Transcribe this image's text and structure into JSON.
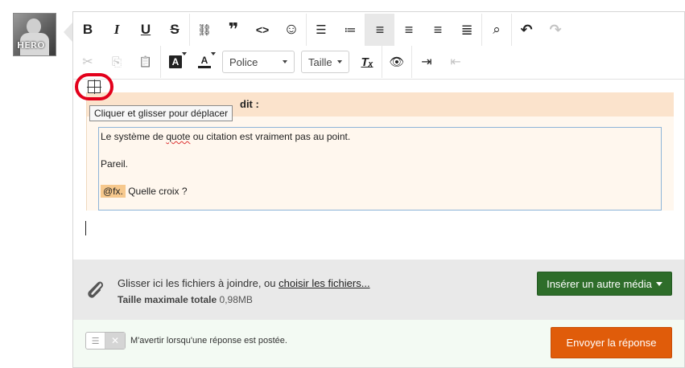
{
  "colors": {
    "accent_red_circle": "#e3001b",
    "media_button": "#2e6d2a",
    "send_button": "#e05c0a",
    "quote_header_bg": "#fbe3cc",
    "mention_bg": "#f6c88d"
  },
  "avatar": {
    "text": "HERO"
  },
  "toolbar": {
    "row1": [
      {
        "name": "bold-button",
        "glyph": "B",
        "icon": "bold-icon"
      },
      {
        "name": "italic-button",
        "glyph": "I",
        "icon": "italic-icon"
      },
      {
        "name": "underline-button",
        "glyph": "U",
        "icon": "underline-icon"
      },
      {
        "name": "strikethrough-button",
        "glyph": "S",
        "icon": "strikethrough-icon"
      },
      {
        "name": "link-button",
        "glyph": "⛓",
        "icon": "link-icon"
      },
      {
        "name": "quote-button",
        "glyph": "❞",
        "icon": "quote-icon"
      },
      {
        "name": "code-button",
        "glyph": "<>",
        "icon": "code-icon"
      },
      {
        "name": "smiley-button",
        "glyph": "☺",
        "icon": "smiley-icon"
      },
      {
        "name": "bullet-list-button",
        "glyph": "☰",
        "icon": "bullet-list-icon"
      },
      {
        "name": "numbered-list-button",
        "glyph": "≔",
        "icon": "numbered-list-icon"
      },
      {
        "name": "align-left-button",
        "glyph": "≡",
        "icon": "align-left-icon"
      },
      {
        "name": "align-center-button",
        "glyph": "≡",
        "icon": "align-center-icon"
      },
      {
        "name": "align-right-button",
        "glyph": "≡",
        "icon": "align-right-icon"
      },
      {
        "name": "justify-button",
        "glyph": "≣",
        "icon": "justify-icon"
      },
      {
        "name": "preview-button",
        "glyph": "⌕",
        "icon": "preview-icon"
      },
      {
        "name": "undo-button",
        "glyph": "↶",
        "icon": "undo-icon"
      },
      {
        "name": "redo-button",
        "glyph": "↷",
        "icon": "redo-icon"
      }
    ],
    "font_dropdown": "Police",
    "size_dropdown": "Taille",
    "bg_color_letter": "A",
    "text_color_letter": "A",
    "clear_format_glyph": "Tₓ",
    "eye_glyph": "👁",
    "indent_glyph": "⇥",
    "outdent_glyph": "⇤",
    "cut_glyph": "✂",
    "copy_glyph": "⎘",
    "paste_glyph": "📋"
  },
  "drag_handle": {
    "tooltip": "Cliquer et glisser pour déplacer"
  },
  "quote": {
    "author_suffix": "dit :",
    "lines": [
      {
        "before": "Le système de ",
        "misspelled": "quote",
        "after": " ou citation est vraiment pas au point."
      },
      {
        "text": "Pareil."
      }
    ],
    "mention": "@fx.",
    "mention_after": " Quelle croix ?"
  },
  "attachments": {
    "prompt_text": "Glisser ici les fichiers à joindre, ou ",
    "link_text": "choisir les fichiers...",
    "max_size_label": "Taille maximale totale",
    "max_size_value": "0,98MB",
    "media_button": "Insérer un autre média"
  },
  "footer": {
    "notify_label": "M'avertir lorsqu'une réponse est postée.",
    "send_button": "Envoyer la réponse"
  }
}
